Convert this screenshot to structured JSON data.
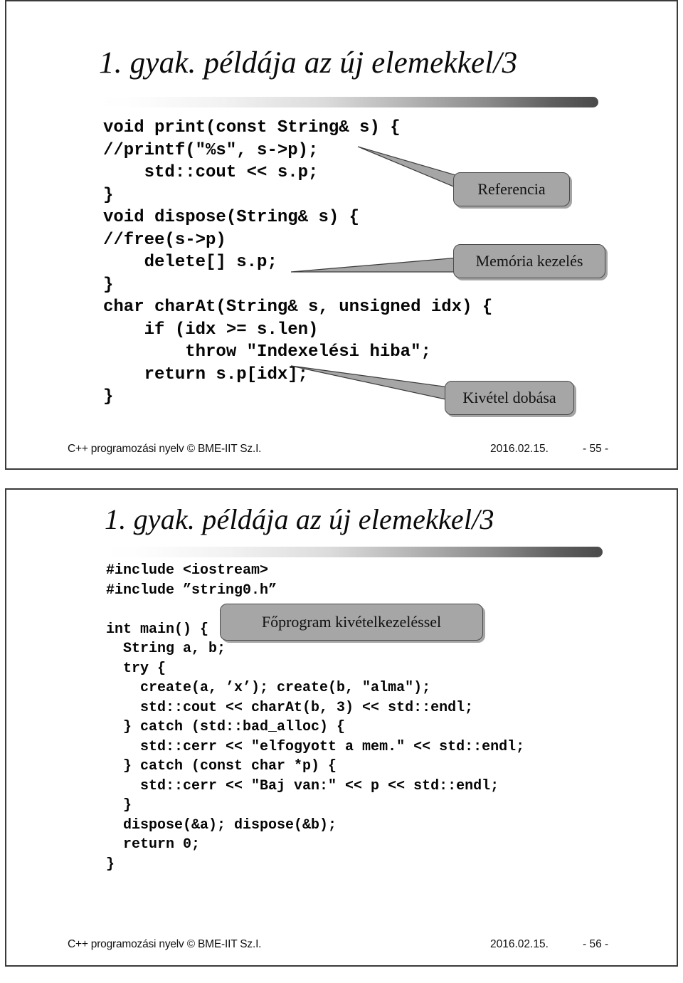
{
  "document": {
    "kind": "lecture-slides",
    "slide_count": 2
  },
  "slide1": {
    "title": "1. gyak. példája az új elemekkel/3",
    "code": "void print(const String& s) {\n//printf(\"%s\", s->p);\n    std::cout << s.p;\n}\nvoid dispose(String& s) {\n//free(s->p)\n    delete[] s.p;\n}\nchar charAt(String& s, unsigned idx) {\n    if (idx >= s.len)\n        throw \"Indexelési hiba\";\n    return s.p[idx];\n}",
    "callouts": [
      {
        "label": "Referencia"
      },
      {
        "label": "Memória kezelés"
      },
      {
        "label": "Kivétel dobása"
      }
    ],
    "footer": {
      "left": "C++ programozási nyelv  © BME-IIT Sz.I.",
      "date": "2016.02.15.",
      "page": "- 55 -"
    }
  },
  "slide2": {
    "title": "1. gyak. példája az új elemekkel/3",
    "code": "#include <iostream>\n#include ”string0.h”\n\nint main() {\n  String a, b;\n  try {\n    create(a, ’x’); create(b, \"alma\");\n    std::cout << charAt(b, 3) << std::endl;\n  } catch (std::bad_alloc) {\n    std::cerr << \"elfogyott a mem.\" << std::endl;\n  } catch (const char *p) {\n    std::cerr << \"Baj van:\" << p << std::endl;\n  }\n  dispose(&a); dispose(&b);\n  return 0;\n}",
    "callouts": [
      {
        "label": "Főprogram kivételkezeléssel"
      }
    ],
    "footer": {
      "left": "C++ programozási nyelv  © BME-IIT Sz.I.",
      "date": "2016.02.15.",
      "page": "- 56 -"
    }
  },
  "colors": {
    "callout_fill": "#a6a6a6",
    "callout_border": "#4a4a4a",
    "slide_border": "#3a3a3a",
    "text": "#050505"
  }
}
